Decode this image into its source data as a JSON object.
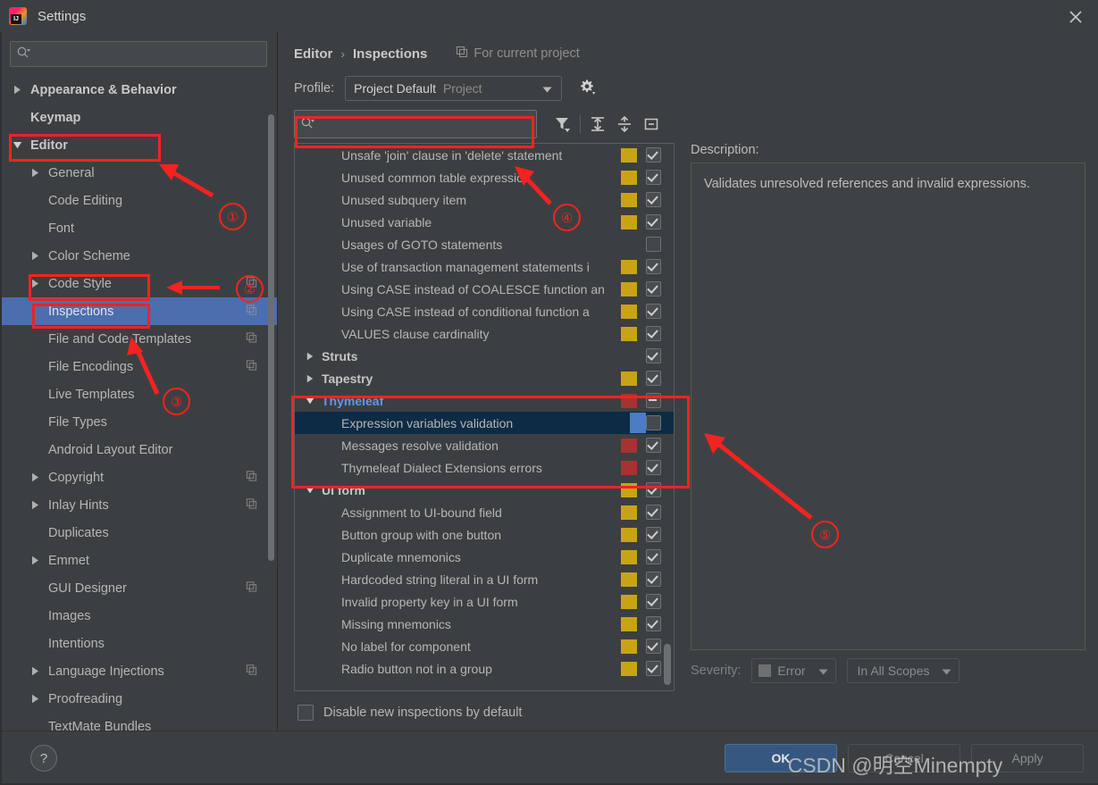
{
  "window": {
    "title": "Settings",
    "logo_icon": "intellij-idea-logo",
    "close_icon": "close-icon"
  },
  "sidebar": {
    "search": {
      "placeholder": "",
      "value": "",
      "icon": "search-icon"
    },
    "items": [
      {
        "label": "Appearance & Behavior",
        "arrow": "right",
        "level": 0,
        "bold": true,
        "copy": false,
        "selected": false
      },
      {
        "label": "Keymap",
        "arrow": "none",
        "level": 0,
        "bold": true,
        "copy": false,
        "selected": false
      },
      {
        "label": "Editor",
        "arrow": "down",
        "level": 0,
        "bold": true,
        "copy": false,
        "selected": false
      },
      {
        "label": "General",
        "arrow": "right",
        "level": 1,
        "bold": false,
        "copy": false,
        "selected": false
      },
      {
        "label": "Code Editing",
        "arrow": "none",
        "level": 1,
        "bold": false,
        "copy": false,
        "selected": false
      },
      {
        "label": "Font",
        "arrow": "none",
        "level": 1,
        "bold": false,
        "copy": false,
        "selected": false
      },
      {
        "label": "Color Scheme",
        "arrow": "right",
        "level": 1,
        "bold": false,
        "copy": false,
        "selected": false
      },
      {
        "label": "Code Style",
        "arrow": "right",
        "level": 1,
        "bold": false,
        "copy": true,
        "selected": false
      },
      {
        "label": "Inspections",
        "arrow": "none",
        "level": 1,
        "bold": false,
        "copy": true,
        "selected": true
      },
      {
        "label": "File and Code Templates",
        "arrow": "none",
        "level": 1,
        "bold": false,
        "copy": true,
        "selected": false
      },
      {
        "label": "File Encodings",
        "arrow": "none",
        "level": 1,
        "bold": false,
        "copy": true,
        "selected": false
      },
      {
        "label": "Live Templates",
        "arrow": "none",
        "level": 1,
        "bold": false,
        "copy": false,
        "selected": false
      },
      {
        "label": "File Types",
        "arrow": "none",
        "level": 1,
        "bold": false,
        "copy": false,
        "selected": false
      },
      {
        "label": "Android Layout Editor",
        "arrow": "none",
        "level": 1,
        "bold": false,
        "copy": false,
        "selected": false
      },
      {
        "label": "Copyright",
        "arrow": "right",
        "level": 1,
        "bold": false,
        "copy": true,
        "selected": false
      },
      {
        "label": "Inlay Hints",
        "arrow": "right",
        "level": 1,
        "bold": false,
        "copy": true,
        "selected": false
      },
      {
        "label": "Duplicates",
        "arrow": "none",
        "level": 1,
        "bold": false,
        "copy": false,
        "selected": false
      },
      {
        "label": "Emmet",
        "arrow": "right",
        "level": 1,
        "bold": false,
        "copy": false,
        "selected": false
      },
      {
        "label": "GUI Designer",
        "arrow": "none",
        "level": 1,
        "bold": false,
        "copy": true,
        "selected": false
      },
      {
        "label": "Images",
        "arrow": "none",
        "level": 1,
        "bold": false,
        "copy": false,
        "selected": false
      },
      {
        "label": "Intentions",
        "arrow": "none",
        "level": 1,
        "bold": false,
        "copy": false,
        "selected": false
      },
      {
        "label": "Language Injections",
        "arrow": "right",
        "level": 1,
        "bold": false,
        "copy": true,
        "selected": false
      },
      {
        "label": "Proofreading",
        "arrow": "right",
        "level": 1,
        "bold": false,
        "copy": false,
        "selected": false
      },
      {
        "label": "TextMate Bundles",
        "arrow": "none",
        "level": 1,
        "bold": false,
        "copy": false,
        "selected": false
      }
    ]
  },
  "header": {
    "breadcrumb": {
      "parent": "Editor",
      "separator": "›",
      "current": "Inspections"
    },
    "for_current_project": "For current project",
    "for_current_project_icon": "copy-icon",
    "profile_label": "Profile:",
    "profile_value": "Project Default",
    "profile_scope": "Project",
    "gear_icon": "gear-icon"
  },
  "toolbar": {
    "search": {
      "placeholder": "",
      "value": "",
      "icon": "search-icon"
    },
    "buttons": [
      {
        "icon": "filter-icon",
        "title": "Filter"
      },
      {
        "icon": "expand-all-icon",
        "title": "Expand All"
      },
      {
        "icon": "collapse-all-icon",
        "title": "Collapse All"
      },
      {
        "icon": "hide-icon",
        "title": "Hide"
      }
    ]
  },
  "inspection_list": [
    {
      "label": "Unsafe 'join' clause in 'delete' statement",
      "level": 1,
      "group": false,
      "arrow": "none",
      "severity": "warning",
      "check": "checked"
    },
    {
      "label": "Unused common table expression",
      "level": 1,
      "group": false,
      "arrow": "none",
      "severity": "warning",
      "check": "checked"
    },
    {
      "label": "Unused subquery item",
      "level": 1,
      "group": false,
      "arrow": "none",
      "severity": "warning",
      "check": "checked"
    },
    {
      "label": "Unused variable",
      "level": 1,
      "group": false,
      "arrow": "none",
      "severity": "warning",
      "check": "checked"
    },
    {
      "label": "Usages of GOTO statements",
      "level": 1,
      "group": false,
      "arrow": "none",
      "severity": "none",
      "check": "empty"
    },
    {
      "label": "Use of transaction management statements i",
      "level": 1,
      "group": false,
      "arrow": "none",
      "severity": "warning",
      "check": "checked"
    },
    {
      "label": "Using CASE instead of COALESCE function an",
      "level": 1,
      "group": false,
      "arrow": "none",
      "severity": "warning",
      "check": "checked"
    },
    {
      "label": "Using CASE instead of conditional function a",
      "level": 1,
      "group": false,
      "arrow": "none",
      "severity": "warning",
      "check": "checked"
    },
    {
      "label": "VALUES clause cardinality",
      "level": 1,
      "group": false,
      "arrow": "none",
      "severity": "warning",
      "check": "checked"
    },
    {
      "label": "Struts",
      "level": 0,
      "group": true,
      "arrow": "right",
      "severity": "none",
      "check": "checked"
    },
    {
      "label": "Tapestry",
      "level": 0,
      "group": true,
      "arrow": "right",
      "severity": "warning",
      "check": "checked"
    },
    {
      "label": "Thymeleaf",
      "level": 0,
      "group": true,
      "arrow": "down",
      "severity": "error",
      "check": "partial",
      "highlight": true
    },
    {
      "label": "Expression variables validation",
      "level": 1,
      "group": false,
      "arrow": "none",
      "severity": "selected",
      "check": "empty",
      "selected": true
    },
    {
      "label": "Messages resolve validation",
      "level": 1,
      "group": false,
      "arrow": "none",
      "severity": "error",
      "check": "checked"
    },
    {
      "label": "Thymeleaf Dialect Extensions errors",
      "level": 1,
      "group": false,
      "arrow": "none",
      "severity": "error",
      "check": "checked"
    },
    {
      "label": "UI form",
      "level": 0,
      "group": true,
      "arrow": "down",
      "severity": "warning",
      "check": "checked"
    },
    {
      "label": "Assignment to UI-bound field",
      "level": 1,
      "group": false,
      "arrow": "none",
      "severity": "warning",
      "check": "checked"
    },
    {
      "label": "Button group with one button",
      "level": 1,
      "group": false,
      "arrow": "none",
      "severity": "warning",
      "check": "checked"
    },
    {
      "label": "Duplicate mnemonics",
      "level": 1,
      "group": false,
      "arrow": "none",
      "severity": "warning",
      "check": "checked"
    },
    {
      "label": "Hardcoded string literal in a UI form",
      "level": 1,
      "group": false,
      "arrow": "none",
      "severity": "warning",
      "check": "checked"
    },
    {
      "label": "Invalid property key in a UI form",
      "level": 1,
      "group": false,
      "arrow": "none",
      "severity": "warning",
      "check": "checked"
    },
    {
      "label": "Missing mnemonics",
      "level": 1,
      "group": false,
      "arrow": "none",
      "severity": "warning",
      "check": "checked"
    },
    {
      "label": "No label for component",
      "level": 1,
      "group": false,
      "arrow": "none",
      "severity": "warning",
      "check": "checked"
    },
    {
      "label": "Radio button not in a group",
      "level": 1,
      "group": false,
      "arrow": "none",
      "severity": "warning",
      "check": "checked"
    }
  ],
  "description": {
    "label": "Description:",
    "text": "Validates unresolved references and invalid expressions."
  },
  "severity_bar": {
    "label": "Severity:",
    "severity_value": "Error",
    "scope_value": "In All Scopes"
  },
  "disable_new": {
    "label": "Disable new inspections by default",
    "checked": false
  },
  "footer": {
    "help_label": "?",
    "ok": "OK",
    "cancel": "Cancel",
    "apply": "Apply"
  },
  "annotations": {
    "markers": [
      {
        "id": "1",
        "label": "①"
      },
      {
        "id": "2",
        "label": "②"
      },
      {
        "id": "3",
        "label": "③"
      },
      {
        "id": "4",
        "label": "④"
      },
      {
        "id": "5",
        "label": "⑤"
      }
    ],
    "color": "#f52222"
  },
  "watermark": {
    "text": "CSDN @明空Minempty"
  },
  "colors": {
    "background": "#3c3f41",
    "selection_blue": "#4b6eaf",
    "row_selected_dark": "#0d2b45",
    "warning": "#c8a415",
    "error": "#a83232",
    "accent_link": "#5b9ae8",
    "primary_button": "#365880",
    "annotation_red": "#f52222"
  }
}
